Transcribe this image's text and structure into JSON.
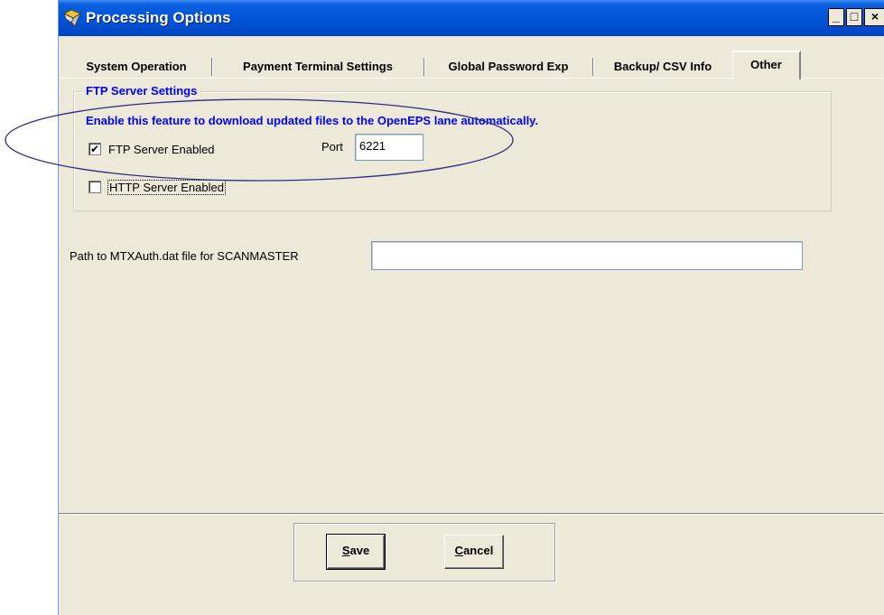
{
  "window": {
    "title": "Processing Options",
    "controls": {
      "minimize": "_",
      "maximize": "□",
      "close": "×"
    }
  },
  "tabs": [
    {
      "label": "System Operation",
      "active": false
    },
    {
      "label": "Payment Terminal Settings",
      "active": false
    },
    {
      "label": "Global Password Exp",
      "active": false
    },
    {
      "label": "Backup/ CSV Info",
      "active": false
    },
    {
      "label": "Other",
      "active": true
    }
  ],
  "ftp_group": {
    "title": "FTP Server Settings",
    "description": "Enable this feature to download updated files to the OpenEPS lane automatically.",
    "ftp_checkbox": {
      "label": "FTP Server Enabled",
      "checked": true,
      "mark": "✔"
    },
    "port_label": "Port",
    "port_value": "6221",
    "http_checkbox": {
      "label": "HTTP Server Enabled",
      "checked": false,
      "mark": ""
    }
  },
  "path": {
    "label": "Path to MTXAuth.dat file for SCANMASTER",
    "value": ""
  },
  "buttons": {
    "save": {
      "accel": "S",
      "rest": "ave"
    },
    "cancel": {
      "accel": "C",
      "rest": "ancel"
    }
  },
  "colors": {
    "titlebar": "#0052d6",
    "window_bg": "#ece9d8",
    "group_text": "#0000ff",
    "annotation_ellipse": "#2b2b86"
  },
  "icons": {
    "app": "app-tool-icon"
  }
}
